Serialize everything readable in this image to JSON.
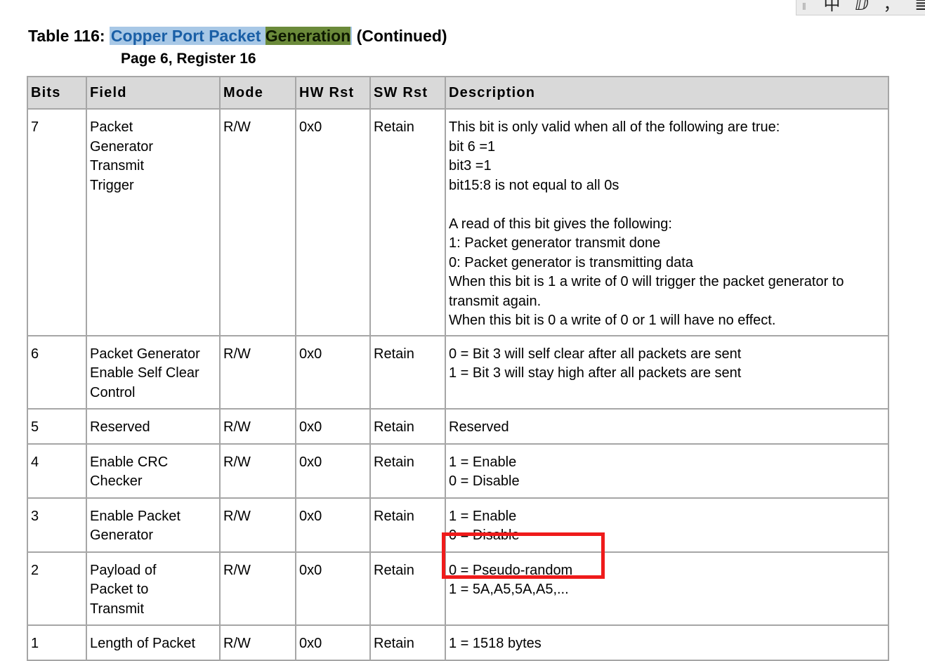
{
  "ime_toolbar": {
    "items": [
      "中",
      "ⅅ",
      "，",
      "≣"
    ]
  },
  "caption": {
    "prefix": "Table 116: ",
    "selected_part1": "Copper Port Packet ",
    "selected_highlight": "Generation",
    "suffix": " (Continued)",
    "subtitle": "Page 6, Register 16"
  },
  "table": {
    "headers": [
      "Bits",
      "Field",
      "Mode",
      "HW Rst",
      "SW Rst",
      "Description"
    ],
    "rows": [
      {
        "bits": "7",
        "field": [
          "Packet",
          "Generator",
          "Transmit",
          "Trigger"
        ],
        "mode": "R/W",
        "hw_rst": "0x0",
        "sw_rst": "Retain",
        "description": [
          "This bit is only valid when all of the following are true:",
          "bit 6 =1",
          "bit3 =1",
          "bit15:8 is not equal to all 0s",
          "",
          "A read of this bit gives the following:",
          "1: Packet generator transmit done",
          "0: Packet generator is transmitting data",
          "When this bit is 1 a write of 0 will trigger the packet generator to",
          "transmit again.",
          "When this bit is 0 a write of 0 or 1 will have no effect."
        ]
      },
      {
        "bits": "6",
        "field": [
          "Packet Generator",
          "Enable Self Clear",
          "Control"
        ],
        "mode": "R/W",
        "hw_rst": "0x0",
        "sw_rst": "Retain",
        "description": [
          "0 = Bit 3 will self clear after all packets are sent",
          "1 = Bit 3 will stay high after all packets are sent"
        ]
      },
      {
        "bits": "5",
        "field": [
          "Reserved"
        ],
        "mode": "R/W",
        "hw_rst": "0x0",
        "sw_rst": "Retain",
        "description": [
          "Reserved"
        ]
      },
      {
        "bits": "4",
        "field": [
          "Enable CRC",
          "Checker"
        ],
        "mode": "R/W",
        "hw_rst": "0x0",
        "sw_rst": "Retain",
        "description": [
          "1 = Enable",
          "0 = Disable"
        ]
      },
      {
        "bits": "3",
        "field": [
          "Enable Packet",
          "Generator"
        ],
        "mode": "R/W",
        "hw_rst": "0x0",
        "sw_rst": "Retain",
        "description": [
          "1 = Enable",
          "0 = Disable"
        ]
      },
      {
        "bits": "2",
        "field": [
          "Payload of",
          "Packet to",
          "Transmit"
        ],
        "mode": "R/W",
        "hw_rst": "0x0",
        "sw_rst": "Retain",
        "description": [
          "0 = Pseudo-random",
          "1 = 5A,A5,5A,A5,..."
        ]
      },
      {
        "bits": "1",
        "field": [
          "Length of Packet"
        ],
        "mode": "R/W",
        "hw_rst": "0x0",
        "sw_rst": "Retain",
        "description": [
          "1 = 1518 bytes"
        ]
      }
    ]
  },
  "annotation": {
    "color": "#ef1b1b"
  }
}
